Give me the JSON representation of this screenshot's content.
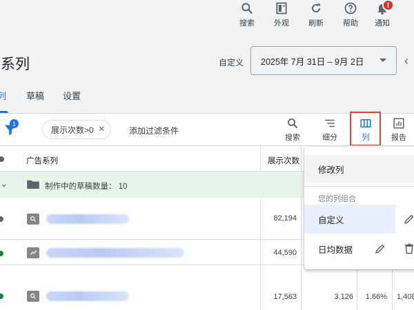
{
  "topbar": {
    "buttons": [
      {
        "label": "搜索",
        "icon": "search-icon"
      },
      {
        "label": "外观",
        "icon": "appearance-icon"
      },
      {
        "label": "刷新",
        "icon": "refresh-icon"
      },
      {
        "label": "帮助",
        "icon": "help-icon"
      },
      {
        "label": "通知",
        "icon": "bell-icon",
        "badge": "!"
      }
    ]
  },
  "header": {
    "title": "告系列",
    "custom_label": "自定义",
    "date_range": "2025年 7月 31日 – 9月 2日"
  },
  "tabs": [
    {
      "label": "列",
      "active": true
    },
    {
      "label": "草稿",
      "active": false
    },
    {
      "label": "设置",
      "active": false
    }
  ],
  "toolbar": {
    "filter_count": "1",
    "filter_chip": "展示次数>0",
    "add_filter": "添加过滤条件",
    "tools": [
      {
        "label": "搜索",
        "icon": "search-icon"
      },
      {
        "label": "细分",
        "icon": "segment-icon"
      },
      {
        "label": "列",
        "icon": "columns-icon"
      },
      {
        "label": "报告",
        "icon": "report-icon"
      }
    ]
  },
  "table": {
    "headers": {
      "campaign": "广告系列",
      "impressions": "展示次数"
    },
    "draft_row": "制作中的草稿数量： 10",
    "rows": [
      {
        "status": "paused",
        "type": "search",
        "impressions": "82,194"
      },
      {
        "status": "enabled",
        "type": "performance",
        "impressions": "44,590"
      },
      {
        "status": "enabled",
        "type": "search",
        "impressions": "17,563",
        "clicks": "3,126",
        "ctr": "1.66%",
        "extra": "1,408"
      }
    ]
  },
  "menu": {
    "edit_columns": "修改列",
    "section_title": "您的列组合",
    "items": [
      {
        "label": "自定义",
        "selected": true
      },
      {
        "label": "日均数据",
        "selected": false
      }
    ]
  },
  "colors": {
    "accent": "#1a73e8",
    "highlight": "#ea4335",
    "enabled": "#188038",
    "paused": "#5f6368",
    "draft_bg": "#e6f4ea"
  }
}
